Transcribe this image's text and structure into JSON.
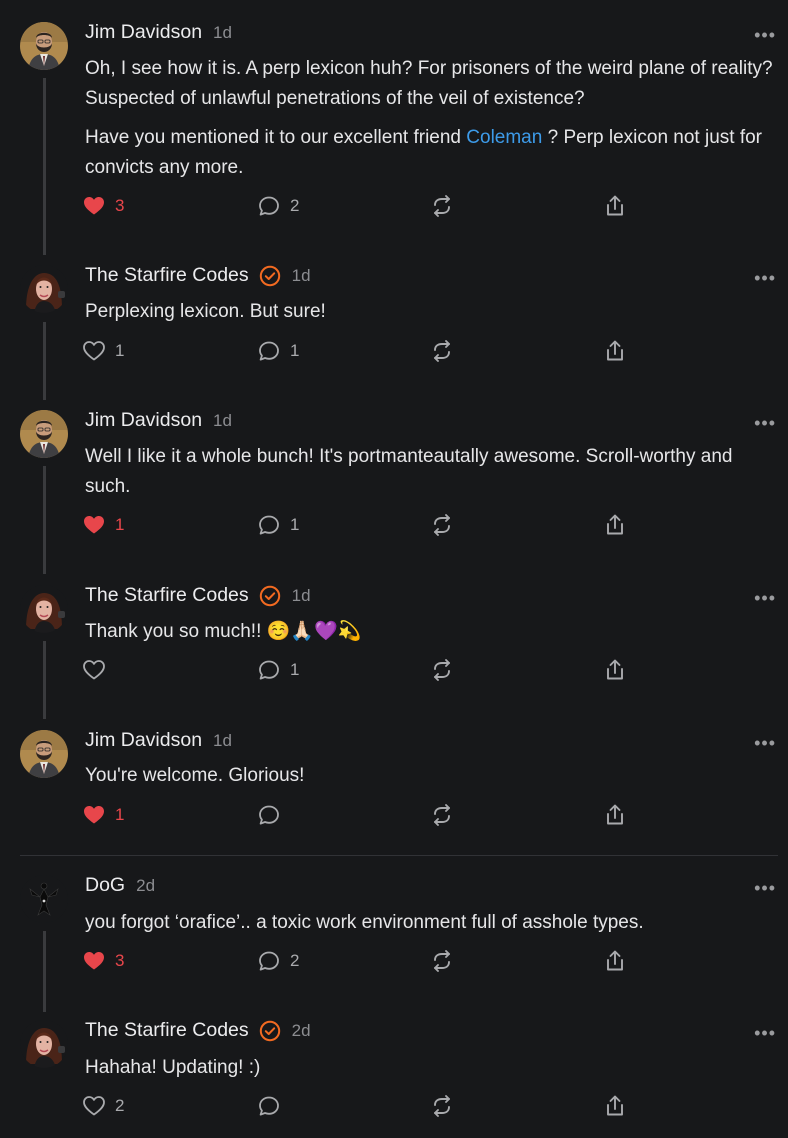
{
  "comments": [
    {
      "author": "Jim Davidson",
      "time": "1d",
      "verified": false,
      "avatar": "jim",
      "paragraphs": [
        {
          "text": "Oh, I see how it is. A perp lexicon huh? For prisoners of the weird plane of reality? Suspected of unlawful penetrations of the veil of existence?"
        },
        {
          "before": "Have you mentioned it to our excellent friend ",
          "link": "Coleman",
          "after": " ? Perp lexicon not just for convicts any more."
        }
      ],
      "likes": "3",
      "liked": true,
      "replies": "2"
    },
    {
      "author": "The Starfire Codes",
      "time": "1d",
      "verified": true,
      "avatar": "starfire",
      "paragraphs": [
        {
          "text": "Perplexing lexicon. But sure!"
        }
      ],
      "likes": "1",
      "liked": false,
      "replies": "1"
    },
    {
      "author": "Jim Davidson",
      "time": "1d",
      "verified": false,
      "avatar": "jim",
      "paragraphs": [
        {
          "text": "Well I like it a whole bunch! It's portmanteautally awesome. Scroll-worthy and such."
        }
      ],
      "likes": "1",
      "liked": true,
      "replies": "1"
    },
    {
      "author": "The Starfire Codes",
      "time": "1d",
      "verified": true,
      "avatar": "starfire",
      "paragraphs": [
        {
          "text": "Thank you so much!! ☺️🙏🏻💜💫"
        }
      ],
      "likes": "",
      "liked": false,
      "replies": "1"
    },
    {
      "author": "Jim Davidson",
      "time": "1d",
      "verified": false,
      "avatar": "jim",
      "paragraphs": [
        {
          "text": "You're welcome. Glorious!"
        }
      ],
      "likes": "1",
      "liked": true,
      "replies": ""
    },
    {
      "author": "DoG",
      "time": "2d",
      "verified": false,
      "avatar": "dog",
      "paragraphs": [
        {
          "text": "you forgot ‘orafice’.. a toxic work environment full of asshole types."
        }
      ],
      "likes": "3",
      "liked": true,
      "replies": "2"
    },
    {
      "author": "The Starfire Codes",
      "time": "2d",
      "verified": true,
      "avatar": "starfire",
      "paragraphs": [
        {
          "text": "Hahaha! Updating! :)"
        }
      ],
      "likes": "2",
      "liked": false,
      "replies": ""
    }
  ],
  "more_menu_glyph": "•••",
  "icons": {
    "like": "heart-icon",
    "reply": "speech-bubble-icon",
    "restack": "restack-icon",
    "share": "share-icon",
    "verified": "verified-check-icon",
    "more": "more-options-icon"
  },
  "colors": {
    "background": "#17181a",
    "liked": "#e8464b",
    "link": "#3d9be9",
    "verified": "#f26a21",
    "muted": "#8c8d91"
  }
}
